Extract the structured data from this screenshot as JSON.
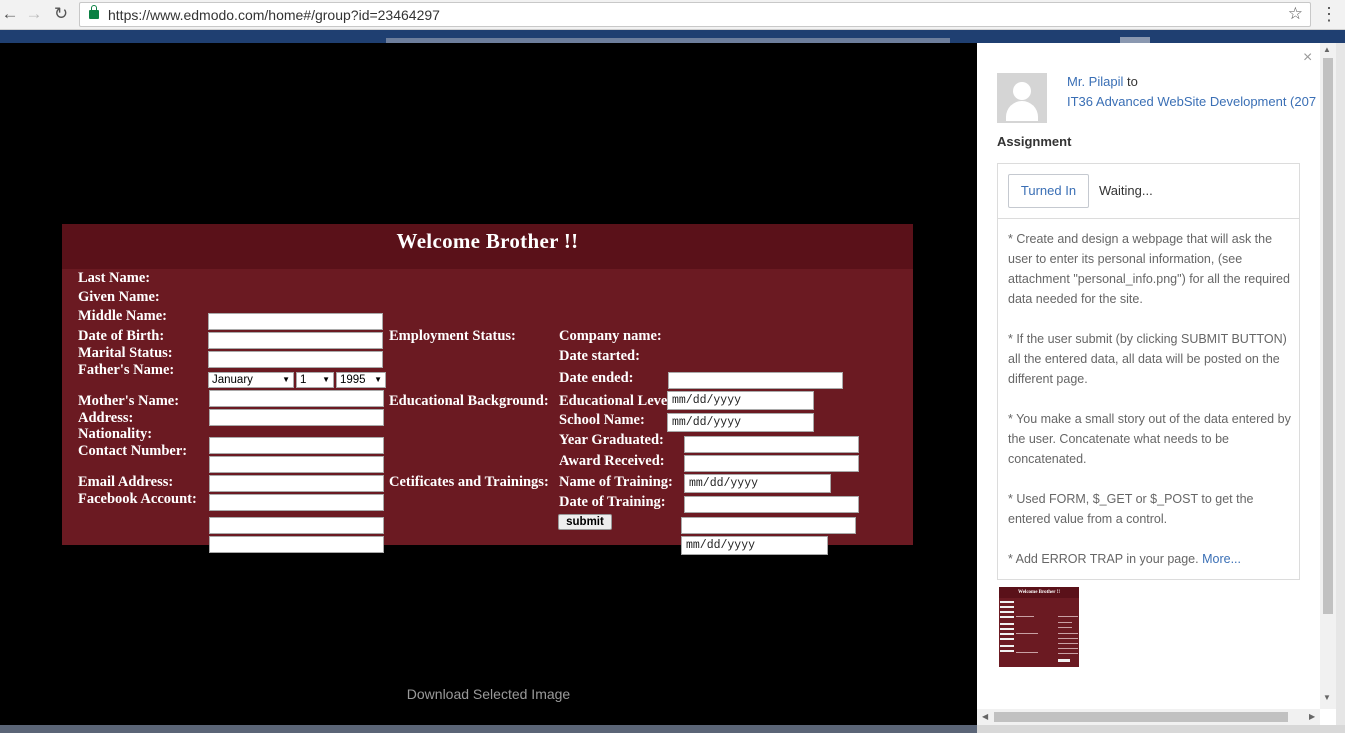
{
  "browser": {
    "back_icon": "←",
    "forward_icon": "→",
    "reload_icon": "↻",
    "url": "https://www.edmodo.com/home#/group?id=23464297",
    "star_icon": "☆",
    "menu_icon": "⋮"
  },
  "viewer": {
    "download_label": "Download Selected Image"
  },
  "form": {
    "title": "Welcome Brother !!",
    "labels": {
      "last_name": "Last Name:",
      "given_name": "Given Name:",
      "middle_name": "Middle Name:",
      "dob": "Date of Birth:",
      "marital": "Marital Status:",
      "father": "Father's Name:",
      "mother": "Mother's Name:",
      "address": "Address:",
      "nationality": "Nationality:",
      "contact": "Contact Number:",
      "email": "Email Address:",
      "facebook": "Facebook Account:",
      "employment": "Employment Status:",
      "educational_bg": "Educational Background:",
      "certificates": "Cetificates and Trainings:",
      "company": "Company name:",
      "date_started": "Date started:",
      "date_ended": "Date ended:",
      "edu_level": "Educational Level:",
      "school": "School Name:",
      "year_grad": "Year Graduated:",
      "award": "Award Received:",
      "training_name": "Name of Training:",
      "training_date": "Date of Training:"
    },
    "dob_month": "January",
    "dob_day": "1",
    "dob_year": "1995",
    "date_placeholder": "mm/dd/yyyy",
    "submit_label": "submit"
  },
  "panel": {
    "close_icon": "×",
    "sender_name": "Mr. Pilapil",
    "sender_to": " to",
    "group_name": "IT36 Advanced WebSite Development (207",
    "assignment_heading": "Assignment",
    "turned_in_label": "Turned In",
    "status_text": "Waiting...",
    "description": [
      "* Create and design a webpage that will ask the user to enter its personal information, (see attachment \"personal_info.png\") for all the required data needed for the site.",
      "* If the user submit (by clicking SUBMIT BUTTON) all the entered data, all data will be posted on the different page.",
      "* You make a small story out of the data entered by the user. Concatenate what needs to be concatenated.",
      "* Used FORM, $_GET or $_POST to get the entered value from a control."
    ],
    "last_line": "* Add ERROR TRAP in your page. ",
    "more_label": "More...",
    "thumb_title": "Welcome Brother !!"
  }
}
